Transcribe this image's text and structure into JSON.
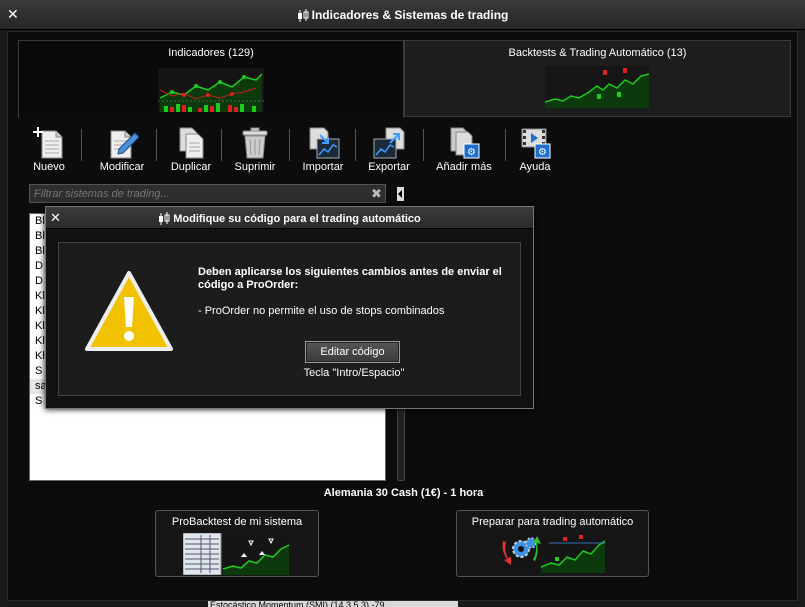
{
  "window": {
    "title": "Indicadores & Sistemas de trading"
  },
  "tabs": [
    {
      "label": "Indicadores (129)"
    },
    {
      "label": "Backtests & Trading Automático (13)"
    }
  ],
  "toolbar": {
    "new": "Nuevo",
    "modify": "Modificar",
    "duplicate": "Duplicar",
    "delete": "Suprimir",
    "import": "Importar",
    "export": "Exportar",
    "add_more": "Añadir más",
    "help": "Ayuda"
  },
  "filter": {
    "placeholder": "Filtrar sistemas de trading..."
  },
  "list": {
    "items": [
      "Bl",
      "Bl",
      "Bl",
      "D",
      "D",
      "Kl",
      "Kl",
      "Kl",
      "Kl",
      "Kl",
      "S",
      "sa",
      "S"
    ],
    "selected_index": 11
  },
  "market": {
    "label": "Alemania 30 Cash (1€) - 1 hora"
  },
  "buttons": {
    "probacktest": "ProBacktest de mi sistema",
    "prepare": "Preparar para trading automático"
  },
  "status_strip": {
    "text": "Estocástico Momentum (SMI) (14,3,5,3) -79"
  },
  "dialog": {
    "title": "Modifique su código para el trading automático",
    "message_bold": "Deben aplicarse los siguientes cambios antes de enviar el código a ProOrder:",
    "message_item": "- ProOrder no permite el uso de stops combinados",
    "edit_button": "Editar código",
    "hint": "Tecla \"Intro/Espacio\""
  },
  "colors": {
    "background": "#0c0c0c",
    "chart_line": "#1fcc1f",
    "chart_red": "#e02020",
    "warning_yellow": "#f2c200",
    "list_bg": "#ffffff"
  }
}
